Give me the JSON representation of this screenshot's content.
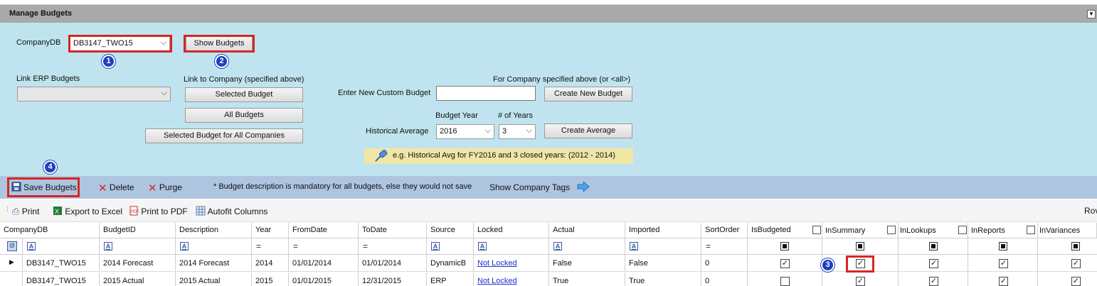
{
  "window": {
    "title": "Manage Budgets"
  },
  "company_selector": {
    "label": "CompanyDB",
    "value": "DB3147_TWO15",
    "show_button": "Show Budgets"
  },
  "link_erp": {
    "label": "Link ERP Budgets",
    "value": "",
    "link_label": "Link to Company (specified above)",
    "selected_budget": "Selected Budget",
    "all_budgets": "All Budgets",
    "selected_all_companies": "Selected Budget for All Companies"
  },
  "custom_budget": {
    "header": "For Company specified above (or <all>)",
    "label": "Enter New Custom Budget",
    "value": "",
    "create_button": "Create New Budget"
  },
  "historical": {
    "budget_year_label": "Budget Year",
    "years_label": "# of Years",
    "label": "Historical Average",
    "budget_year": "2016",
    "num_years": "3",
    "create_button": "Create Average",
    "hint": "e.g. Historical Avg for FY2016 and 3 closed years: (2012 - 2014)"
  },
  "markers": [
    "1",
    "2",
    "3",
    "4"
  ],
  "toolbar": {
    "save": "Save Budgets",
    "delete": "Delete",
    "purge": "Purge",
    "note": "* Budget description is mandatory for all budgets, else they would not save",
    "show_tags": "Show Company Tags"
  },
  "grid_toolbar": {
    "print": "Print",
    "export_excel": "Export to Excel",
    "print_pdf": "Print to PDF",
    "autofit": "Autofit Columns",
    "right_text": "Rov"
  },
  "columns": [
    "CompanyDB",
    "BudgetID",
    "Description",
    "Year",
    "FromDate",
    "ToDate",
    "Source",
    "Locked",
    "Actual",
    "Imported",
    "SortOrder",
    "IsBudgeted",
    "InSummary",
    "InLookups",
    "InReports",
    "InVariances"
  ],
  "rows": [
    {
      "CompanyDB": "DB3147_TWO15",
      "BudgetID": "2014 Forecast",
      "Description": "2014 Forecast",
      "Year": "2014",
      "FromDate": "01/01/2014",
      "ToDate": "01/01/2014",
      "Source": "DynamicB",
      "Locked": "Not Locked",
      "Actual": "False",
      "Imported": "False",
      "SortOrder": "0",
      "IsBudgeted": true,
      "InSummary": true,
      "InLookups": true,
      "InReports": true,
      "InVariances": true
    },
    {
      "CompanyDB": "DB3147_TWO15",
      "BudgetID": "2015 Actual",
      "Description": "2015 Actual",
      "Year": "2015",
      "FromDate": "01/01/2015",
      "ToDate": "12/31/2015",
      "Source": "ERP",
      "Locked": "Not Locked",
      "Actual": "True",
      "Imported": "True",
      "SortOrder": "0",
      "IsBudgeted": false,
      "InSummary": true,
      "InLookups": true,
      "InReports": true,
      "InVariances": true
    }
  ]
}
